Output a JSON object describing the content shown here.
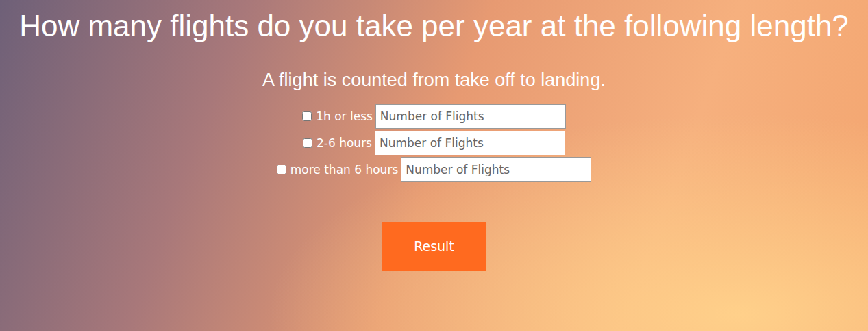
{
  "title": "How many flights do you take per year at the following length?",
  "subtitle": "A flight is counted from take off to landing.",
  "rows": [
    {
      "label": "1h or less",
      "checked": false,
      "placeholder": "Number of Flights"
    },
    {
      "label": "2-6 hours",
      "checked": false,
      "placeholder": "Number of Flights"
    },
    {
      "label": "more than 6 hours",
      "checked": false,
      "placeholder": "Number of Flights"
    }
  ],
  "button": "Result"
}
